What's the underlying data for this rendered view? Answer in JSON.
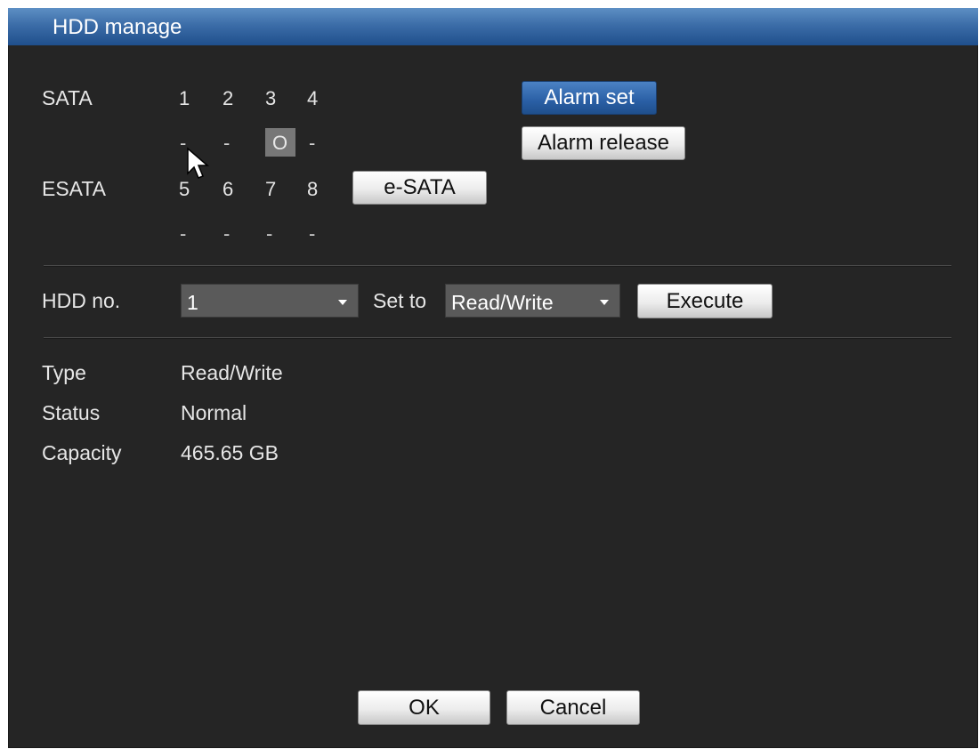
{
  "window": {
    "title": "HDD manage"
  },
  "sata": {
    "label": "SATA",
    "ports": [
      "1",
      "2",
      "3",
      "4"
    ],
    "status": [
      "-",
      "-",
      "O",
      "-"
    ]
  },
  "esata": {
    "label": "ESATA",
    "ports": [
      "5",
      "6",
      "7",
      "8"
    ],
    "status": [
      "-",
      "-",
      "-",
      "-"
    ],
    "button": "e-SATA"
  },
  "alarm": {
    "set": "Alarm set",
    "release": "Alarm release"
  },
  "hdd_control": {
    "label": "HDD no.",
    "hdd_value": "1",
    "set_to_label": "Set to",
    "mode_value": "Read/Write",
    "execute": "Execute"
  },
  "info": {
    "type_label": "Type",
    "type_value": "Read/Write",
    "status_label": "Status",
    "status_value": "Normal",
    "capacity_label": "Capacity",
    "capacity_value": "465.65 GB"
  },
  "footer": {
    "ok": "OK",
    "cancel": "Cancel"
  },
  "colors": {
    "title_bar": "#2a5fa5",
    "panel_bg": "#252525",
    "selected_slot": "#777777"
  },
  "icons": {
    "dropdown": "chevron-down-icon",
    "pointer": "mouse-cursor-icon"
  }
}
